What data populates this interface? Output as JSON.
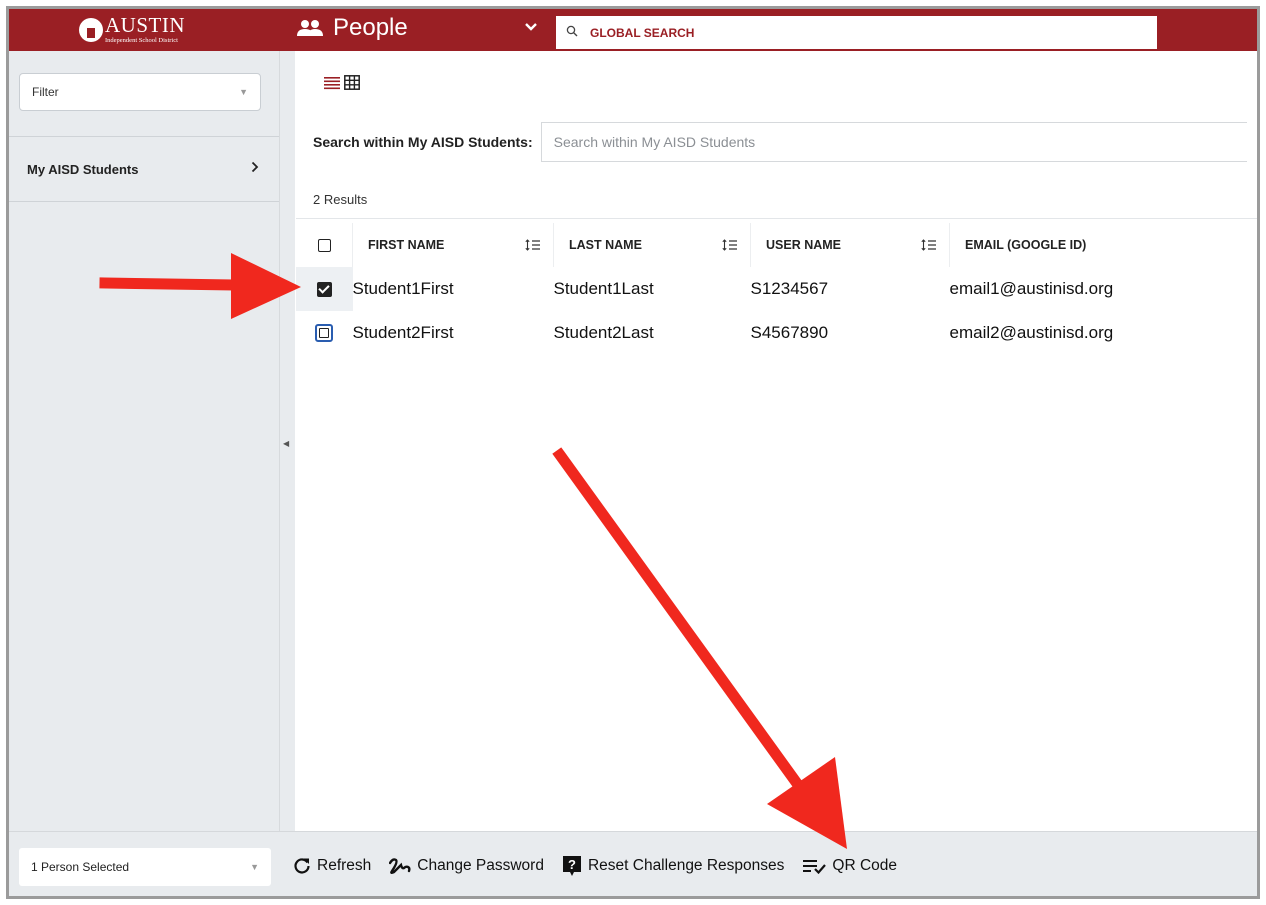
{
  "header": {
    "logo_word": "AUSTIN",
    "logo_sub": "Independent School District",
    "module_title": "People",
    "global_search_placeholder": "GLOBAL SEARCH",
    "brand_color": "#9a1f24"
  },
  "sidebar": {
    "filter_placeholder": "Filter",
    "items": [
      {
        "label": "My AISD Students"
      }
    ]
  },
  "main": {
    "search_label": "Search within My AISD Students:",
    "search_placeholder": "Search within My AISD Students",
    "results_count": "2 Results",
    "columns": [
      "FIRST NAME",
      "LAST NAME",
      "USER NAME",
      "EMAIL (GOOGLE ID)"
    ],
    "rows": [
      {
        "first": "Student1First",
        "last": "Student1Last",
        "user": "S1234567",
        "email": "email1@austinisd.org",
        "checked": true
      },
      {
        "first": "Student2First",
        "last": "Student2Last",
        "user": "S4567890",
        "email": "email2@austinisd.org",
        "checked": false
      }
    ]
  },
  "footer": {
    "selection": "1 Person Selected",
    "actions": {
      "refresh": "Refresh",
      "change_password": "Change Password",
      "reset_challenge": "Reset Challenge Responses",
      "qr_code": "QR Code"
    }
  },
  "icons": {
    "people": "people-icon",
    "chevron": "chevron-down-icon",
    "search": "search-icon",
    "list_view": "list-view-icon",
    "grid_view": "grid-view-icon",
    "sort": "sort-icon",
    "refresh": "refresh-icon",
    "password": "signature-icon",
    "help": "question-icon",
    "qr": "checklist-icon"
  },
  "annotation_color": "#f0281e"
}
